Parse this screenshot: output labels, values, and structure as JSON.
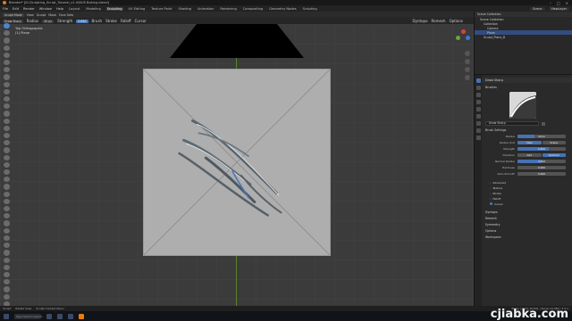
{
  "window": {
    "title": "Blender* [D:\\Sculpting_Script_Tutorial_v1.0\\NUS Baking.blend]",
    "controls": [
      "–",
      "□",
      "×"
    ]
  },
  "menu": {
    "items": [
      "File",
      "Edit",
      "Render",
      "Window",
      "Help"
    ],
    "workspaces": [
      "Layout",
      "Modeling",
      "Sculpting",
      "UV Editing",
      "Texture Paint",
      "Shading",
      "Animation",
      "Rendering",
      "Compositing",
      "Geometry Nodes",
      "Scripting"
    ],
    "active_workspace": "Sculpting",
    "scene": "Scene",
    "view_layer": "ViewLayer"
  },
  "header": {
    "mode": "Sculpt Mode",
    "items": [
      "View",
      "Sculpt",
      "Mask",
      "Face Sets"
    ]
  },
  "tool_header": {
    "brush": "Draw Sharp",
    "items": [
      "Radius",
      "Strength",
      "Brush",
      "Stroke",
      "Falloff",
      "Cursor"
    ],
    "radius_value": "40 px",
    "strength_value": "0.650",
    "right_items": [
      "Dyntopo",
      "Remesh",
      "Options"
    ]
  },
  "viewport": {
    "info_line1": "Top Orthographic",
    "info_line2": "(1) Plane",
    "gizmo_colors": [
      "#d64242",
      "#6aa63a",
      "#3f76d6"
    ]
  },
  "outliner": {
    "header": "Scene Collection",
    "rows": [
      {
        "label": "Scene Collection",
        "indent": 0,
        "selected": false
      },
      {
        "label": "Collection",
        "indent": 1,
        "selected": false
      },
      {
        "label": "Camera",
        "indent": 2,
        "selected": false
      },
      {
        "label": "Plane",
        "indent": 2,
        "selected": true
      },
      {
        "label": "Sculpt_Plane_B",
        "indent": 1,
        "selected": false
      }
    ]
  },
  "properties": {
    "title": "Draw Sharp",
    "brushes_header": "Brushes",
    "brush_name": "Draw Sharp",
    "brush_settings_header": "Brush Settings",
    "fields": [
      {
        "label": "Radius",
        "value": "40 px",
        "fill": 0.35
      },
      {
        "label": "Radius Unit",
        "segs": [
          "View",
          "Scene"
        ],
        "on": 0
      },
      {
        "label": "Strength",
        "value": "0.650",
        "fill": 0.65
      },
      {
        "label": "Direction",
        "segs": [
          "Add",
          "Subtract"
        ],
        "on": 1
      },
      {
        "label": "Normal Radius",
        "value": "0.500",
        "fill": 0.5
      },
      {
        "label": "Hardness",
        "value": "0.000",
        "fill": 0.0
      },
      {
        "label": "Auto-Smooth",
        "value": "0.000",
        "fill": 0.0
      }
    ],
    "sub_panels": [
      "Advanced",
      "Texture",
      "Stroke",
      "Falloff",
      "Cursor"
    ],
    "sections": [
      "Dyntopo",
      "Remesh",
      "Symmetry",
      "Options",
      "Workspace"
    ]
  },
  "status": {
    "items": [
      "Sculpt",
      "Rotate View",
      "Sculpt Context Menu",
      "Plane | Verts 16,641 | Faces 16,384 | 3.3.1"
    ]
  },
  "taskbar": {
    "search_placeholder": "Type here to search"
  },
  "watermark": "cjiabka.com"
}
